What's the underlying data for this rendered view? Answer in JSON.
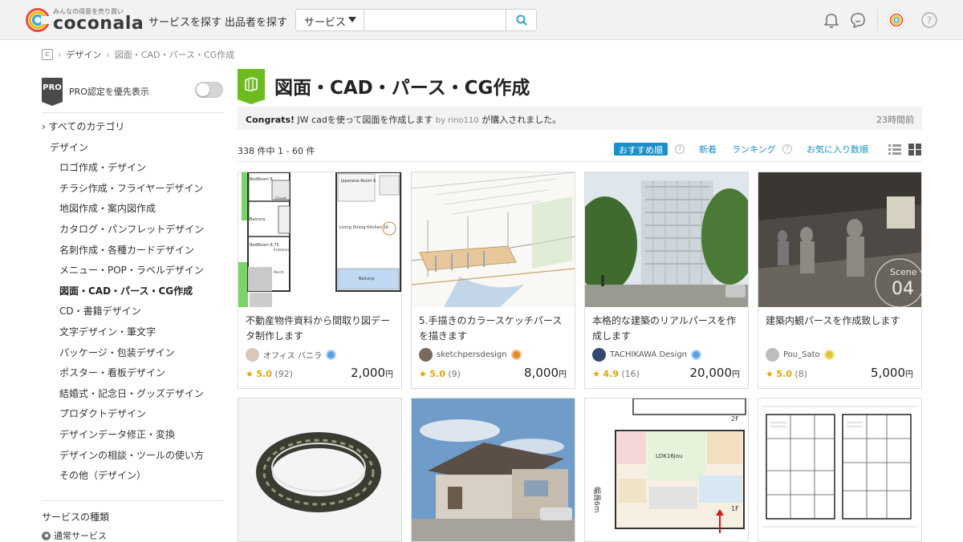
{
  "header": {
    "logo_tagline": "みんなの得意を売り買い",
    "logo_text": "coconala",
    "nav_services": "サービスを探す",
    "nav_sellers": "出品者を探す",
    "search_category": "サービス",
    "search_placeholder": ""
  },
  "breadcrumb": {
    "home_icon": "c",
    "items": [
      "デザイン",
      "図面・CAD・パース・CG作成"
    ]
  },
  "sidebar": {
    "pro_badge": "PRO",
    "pro_label": "PRO認定を優先表示",
    "pro_toggle_on": false,
    "categories": [
      {
        "label": "すべてのカテゴリ",
        "level": 0,
        "prefix": "›"
      },
      {
        "label": "デザイン",
        "level": 1
      },
      {
        "label": "ロゴ作成・デザイン",
        "level": 2
      },
      {
        "label": "チラシ作成・フライヤーデザイン",
        "level": 2
      },
      {
        "label": "地図作成・案内図作成",
        "level": 2
      },
      {
        "label": "カタログ・パンフレットデザイン",
        "level": 2
      },
      {
        "label": "名刺作成・各種カードデザイン",
        "level": 2
      },
      {
        "label": "メニュー・POP・ラベルデザイン",
        "level": 2
      },
      {
        "label": "図面・CAD・パース・CG作成",
        "level": 2,
        "active": true
      },
      {
        "label": "CD・書籍デザイン",
        "level": 2
      },
      {
        "label": "文字デザイン・筆文字",
        "level": 2
      },
      {
        "label": "パッケージ・包装デザイン",
        "level": 2
      },
      {
        "label": "ポスター・看板デザイン",
        "level": 2
      },
      {
        "label": "結婚式・記念日・グッズデザイン",
        "level": 2
      },
      {
        "label": "プロダクトデザイン",
        "level": 2
      },
      {
        "label": "デザインデータ修正・変換",
        "level": 2
      },
      {
        "label": "デザインの相談・ツールの使い方",
        "level": 2
      },
      {
        "label": "その他（デザイン）",
        "level": 2
      }
    ],
    "service_types_heading": "サービスの種類",
    "service_type_selected": "通常サービス"
  },
  "main": {
    "title": "図面・CAD・パース・CG作成",
    "congrats": {
      "prefix": "Congrats!",
      "service": " JW cadを使って図面を作成します ",
      "by": "by rino110",
      "suffix": " が購入されました。",
      "time": "23時間前"
    },
    "result_count": "338 件中 1 - 60 件",
    "sort": {
      "recommended": "おすすめ順",
      "newest": "新着",
      "ranking": "ランキング",
      "favorites": "お気に入り数順",
      "help": "?"
    },
    "cards": [
      {
        "title": "不動産物件資料から間取り図データ制作します",
        "seller": "オフィス バニラ",
        "rating": "5.0",
        "reviews": "(92)",
        "price": "2,000",
        "yen": "円"
      },
      {
        "title": "5.手描きのカラースケッチパースを描きます",
        "seller": "sketchpersdesign",
        "rating": "5.0",
        "reviews": "(9)",
        "price": "8,000",
        "yen": "円"
      },
      {
        "title": "本格的な建築のリアルパースを作成します",
        "seller": "TACHIKAWA Design",
        "rating": "4.9",
        "reviews": "(16)",
        "price": "20,000",
        "yen": "円"
      },
      {
        "title": "建築内観パースを作成致します",
        "seller": "Pou_Sato",
        "rating": "5.0",
        "reviews": "(8)",
        "price": "5,000",
        "yen": "円"
      }
    ],
    "thumb_texts": {
      "plan_rooms": [
        "BedRoom 6",
        "Closet",
        "Balcony",
        "BedRoom 6.75",
        "Entrance",
        "Porch",
        "Japanese Room 6",
        "Living Dining Kitchen 16",
        "Balcony"
      ],
      "scene_label": "Scene",
      "scene_num": "04",
      "plan2_label_floor2": "2F",
      "plan2_label_floor1": "1F",
      "plan2_ldk": "LDK16jou",
      "plan2_width": "幅員6m"
    },
    "star": "★"
  },
  "colors": {
    "accent_blue": "#1a8fc9",
    "category_green": "#6dbb1e",
    "star": "#e5a100"
  }
}
